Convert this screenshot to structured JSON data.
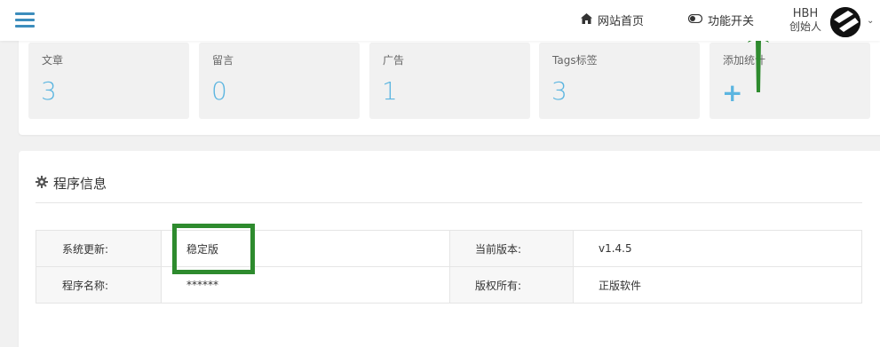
{
  "navbar": {
    "home_label": "网站首页",
    "func_label": "功能开关",
    "user_name": "HBH",
    "user_role": "创始人"
  },
  "stats": [
    {
      "label": "文章",
      "value": "3"
    },
    {
      "label": "留言",
      "value": "0"
    },
    {
      "label": "广告",
      "value": "1"
    },
    {
      "label": "Tags标签",
      "value": "3"
    },
    {
      "label": "添加统计",
      "value": "+"
    }
  ],
  "info": {
    "title": "程序信息",
    "rows": [
      {
        "label1": "系统更新:",
        "value1": "稳定版",
        "label2": "当前版本:",
        "value2": "v1.4.5"
      },
      {
        "label1": "程序名称:",
        "value1": "******",
        "label2": "版权所有:",
        "value2": "正版软件"
      }
    ]
  },
  "colors": {
    "accent": "#5bb5e0",
    "hamburger": "#3c8dbc",
    "annotation": "#2e8b2e"
  },
  "icons": [
    "menu-icon",
    "home-icon",
    "toggle-icon",
    "chevron-down-icon",
    "gear-icon"
  ]
}
